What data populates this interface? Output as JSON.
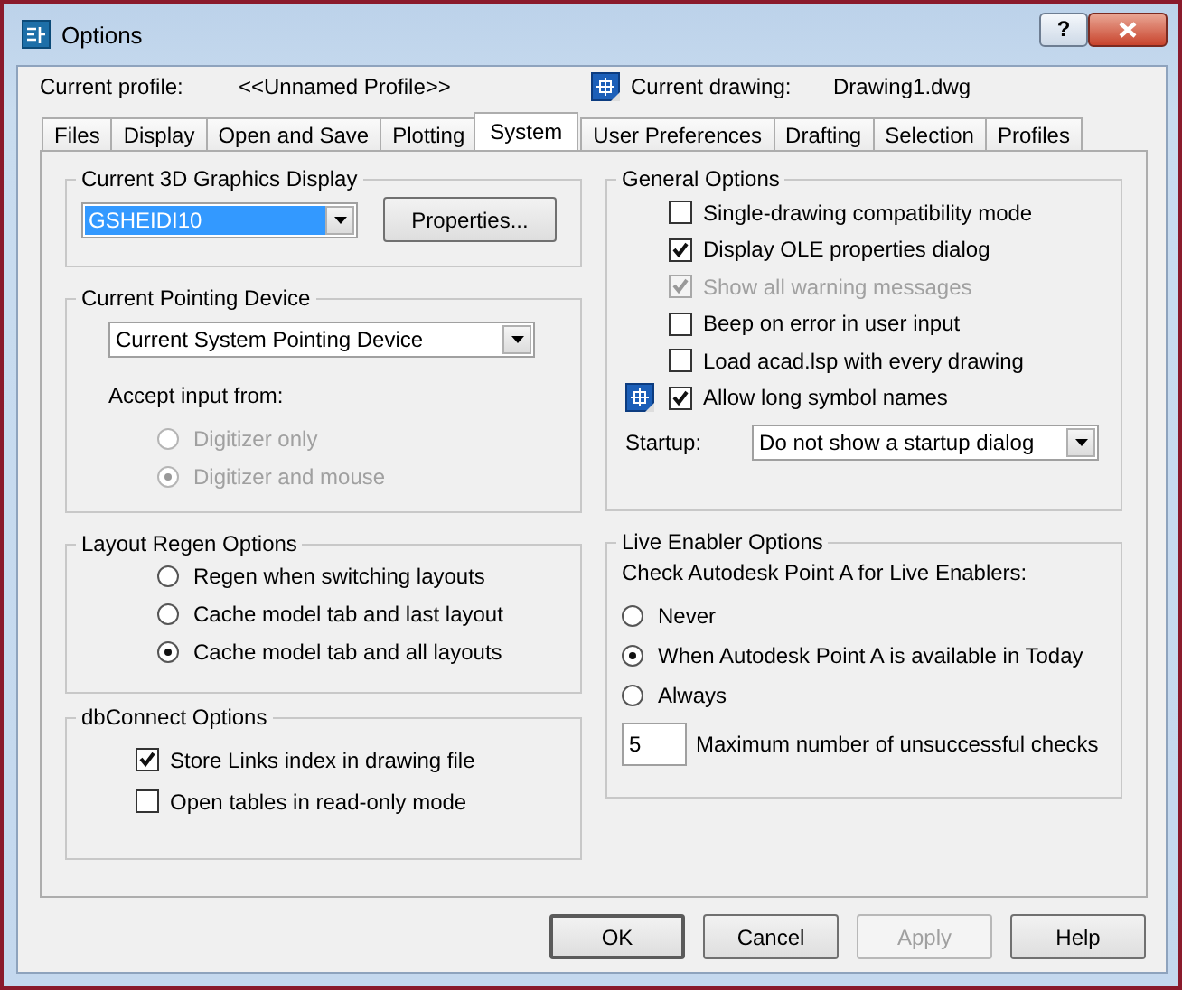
{
  "window": {
    "title": "Options",
    "help_button": "?"
  },
  "header": {
    "profile_label": "Current profile:",
    "profile_value": "<<Unnamed Profile>>",
    "drawing_label": "Current drawing:",
    "drawing_value": "Drawing1.dwg"
  },
  "tabs": [
    {
      "label": "Files",
      "selected": false
    },
    {
      "label": "Display",
      "selected": false
    },
    {
      "label": "Open and Save",
      "selected": false
    },
    {
      "label": "Plotting",
      "selected": false
    },
    {
      "label": "System",
      "selected": true
    },
    {
      "label": "User Preferences",
      "selected": false
    },
    {
      "label": "Drafting",
      "selected": false
    },
    {
      "label": "Selection",
      "selected": false
    },
    {
      "label": "Profiles",
      "selected": false
    }
  ],
  "graphics_display": {
    "title": "Current 3D Graphics Display",
    "dropdown": {
      "value": "GSHEIDI10",
      "focused": true
    },
    "button": "Properties..."
  },
  "pointing_device": {
    "title": "Current Pointing Device",
    "dropdown": {
      "value": "Current System Pointing Device",
      "focused": false
    },
    "accept_label": "Accept input from:",
    "options": [
      {
        "label": "Digitizer only",
        "selected": false,
        "disabled": true
      },
      {
        "label": "Digitizer and mouse",
        "selected": true,
        "disabled": true
      }
    ]
  },
  "layout_regen": {
    "title": "Layout Regen Options",
    "options": [
      {
        "label": "Regen when switching layouts",
        "selected": false,
        "disabled": false
      },
      {
        "label": "Cache model tab and last layout",
        "selected": false,
        "disabled": false
      },
      {
        "label": "Cache model tab and all layouts",
        "selected": true,
        "disabled": false
      }
    ]
  },
  "dbconnect": {
    "title": "dbConnect Options",
    "checkboxes": [
      {
        "label": "Store Links index in drawing file",
        "checked": true,
        "disabled": false
      },
      {
        "label": "Open tables in read-only mode",
        "checked": false,
        "disabled": false
      }
    ]
  },
  "general_options": {
    "title": "General Options",
    "checkboxes": [
      {
        "label": "Single-drawing compatibility mode",
        "checked": false,
        "disabled": false,
        "kind": "plain"
      },
      {
        "label": "Display OLE properties dialog",
        "checked": true,
        "disabled": false,
        "kind": "plain"
      },
      {
        "label": "Show all warning messages",
        "checked": true,
        "disabled": true,
        "kind": "plain"
      },
      {
        "label": "Beep on error in user input",
        "checked": false,
        "disabled": false,
        "kind": "plain"
      },
      {
        "label": "Load acad.lsp with every drawing",
        "checked": false,
        "disabled": false,
        "kind": "plain"
      },
      {
        "label": "Allow long symbol names",
        "checked": true,
        "disabled": false,
        "kind": "drawing-setting"
      }
    ],
    "startup": {
      "label": "Startup:",
      "dropdown": {
        "value": "Do not show a startup dialog",
        "focused": false
      }
    }
  },
  "live_enabler": {
    "title": "Live Enabler Options",
    "prompt": "Check Autodesk Point A for Live Enablers:",
    "options": [
      {
        "label": "Never",
        "selected": false,
        "disabled": false
      },
      {
        "label": "When Autodesk Point A is available in Today",
        "selected": true,
        "disabled": false
      },
      {
        "label": "Always",
        "selected": false,
        "disabled": false
      }
    ],
    "max_checks": {
      "value": "5",
      "label": "Maximum number of unsuccessful checks"
    }
  },
  "buttons": [
    {
      "label": "OK",
      "disabled": false,
      "default": true
    },
    {
      "label": "Cancel",
      "disabled": false,
      "default": false
    },
    {
      "label": "Apply",
      "disabled": true,
      "default": false
    },
    {
      "label": "Help",
      "disabled": false,
      "default": false
    }
  ]
}
